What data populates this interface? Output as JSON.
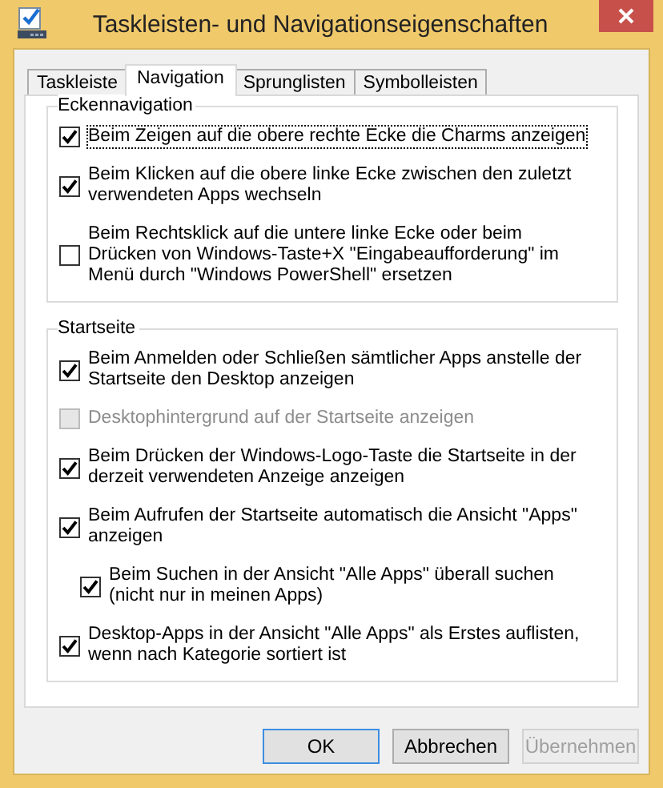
{
  "window": {
    "title": "Taskleisten- und Navigationseigenschaften"
  },
  "tabs": [
    {
      "label": "Taskleiste",
      "selected": false
    },
    {
      "label": "Navigation",
      "selected": true
    },
    {
      "label": "Sprunglisten",
      "selected": false
    },
    {
      "label": "Symbolleisten",
      "selected": false
    }
  ],
  "groups": [
    {
      "title": "Eckennavigation",
      "options": [
        {
          "label": "Beim Zeigen auf die obere rechte Ecke die Charms anzeigen",
          "checked": true,
          "disabled": false,
          "focused": true
        },
        {
          "label": "Beim Klicken auf die obere linke Ecke zwischen den zuletzt verwendeten Apps wechseln",
          "checked": true,
          "disabled": false,
          "focused": false
        },
        {
          "label": "Beim Rechtsklick auf die untere linke Ecke oder beim Drücken von Windows-Taste+X \"Eingabeaufforderung\" im Menü durch \"Windows PowerShell\" ersetzen",
          "checked": false,
          "disabled": false,
          "focused": false
        }
      ]
    },
    {
      "title": "Startseite",
      "options": [
        {
          "label": "Beim Anmelden oder Schließen sämtlicher Apps anstelle der Startseite den Desktop anzeigen",
          "checked": true,
          "disabled": false,
          "focused": false
        },
        {
          "label": "Desktophintergrund auf der Startseite anzeigen",
          "checked": false,
          "disabled": true,
          "focused": false
        },
        {
          "label": "Beim Drücken der Windows-Logo-Taste die Startseite in der derzeit verwendeten Anzeige anzeigen",
          "checked": true,
          "disabled": false,
          "focused": false
        },
        {
          "label": "Beim Aufrufen der Startseite automatisch die Ansicht \"Apps\" anzeigen",
          "checked": true,
          "disabled": false,
          "focused": false,
          "children": [
            {
              "label": "Beim Suchen in der Ansicht \"Alle Apps\" überall suchen (nicht nur in meinen Apps)",
              "checked": true,
              "disabled": false,
              "focused": false
            }
          ]
        },
        {
          "label": "Desktop-Apps in der Ansicht \"Alle Apps\" als Erstes auflisten, wenn nach Kategorie sortiert ist",
          "checked": true,
          "disabled": false,
          "focused": false
        }
      ]
    }
  ],
  "buttons": [
    {
      "label": "OK",
      "default": true,
      "disabled": false
    },
    {
      "label": "Abbrechen",
      "default": false,
      "disabled": false
    },
    {
      "label": "Übernehmen",
      "default": false,
      "disabled": true
    }
  ]
}
